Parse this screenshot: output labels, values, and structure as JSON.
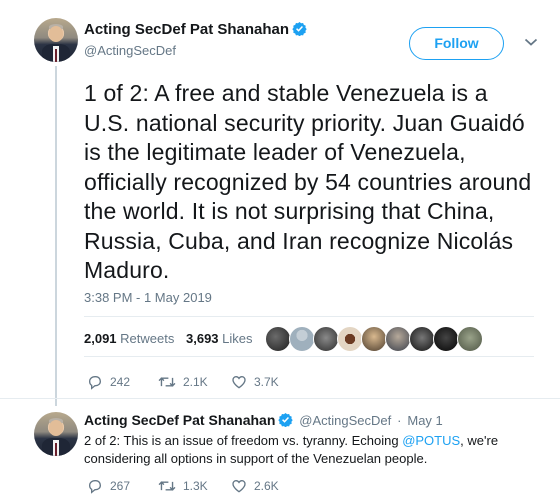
{
  "tweet": {
    "author_name": "Acting SecDef Pat Shanahan",
    "author_handle": "@ActingSecDef",
    "follow_label": "Follow",
    "text": "1 of 2:  A free and stable Venezuela is a U.S. national security priority. Juan Guaidó is the legitimate leader of Venezuela, officially recognized by 54 countries around the world. It is not surprising that China, Russia, Cuba, and Iran recognize Nicolás Maduro.",
    "timestamp": "3:38 PM - 1 May 2019",
    "retweets_count": "2,091",
    "retweets_label": "Retweets",
    "likes_count": "3,693",
    "likes_label": "Likes",
    "actions": {
      "replies": "242",
      "retweets": "2.1K",
      "likes": "3.7K"
    }
  },
  "reply": {
    "author_name": "Acting SecDef Pat Shanahan",
    "author_handle": "@ActingSecDef",
    "date": "May 1",
    "text_before": "2 of 2: This is an issue of freedom vs. tyranny.  Echoing ",
    "mention": "@POTUS",
    "text_after": ", we're considering all options in support of the Venezuelan people.",
    "actions": {
      "replies": "267",
      "retweets": "1.3K",
      "likes": "2.6K"
    }
  },
  "icons": {
    "verified": "verified-badge-icon",
    "chevron": "chevron-down-icon",
    "reply": "reply-icon",
    "retweet": "retweet-icon",
    "like": "heart-icon"
  },
  "colors": {
    "accent": "#1da1f2",
    "text": "#14171a",
    "muted": "#657786"
  }
}
